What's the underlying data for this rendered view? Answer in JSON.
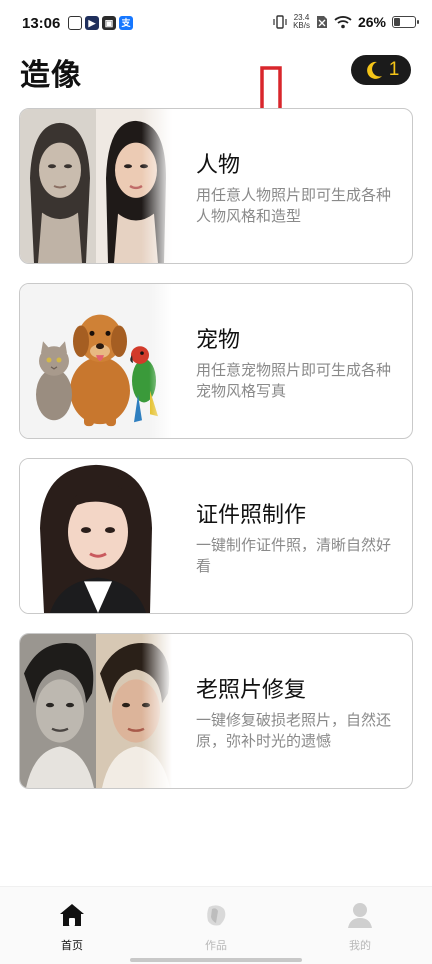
{
  "status_bar": {
    "time": "13:06",
    "speed_value": "23.4",
    "speed_unit": "KB/s",
    "battery": "26%",
    "battery_level": 0.26,
    "icons": [
      "app-icon",
      "play-icon",
      "wallet-icon",
      "alipay-icon",
      "vibrate-icon",
      "sim-off-icon",
      "wifi-icon",
      "battery-icon"
    ]
  },
  "header": {
    "title": "造像",
    "credits": "1",
    "credit_icon": "moon-icon",
    "credit_color": "#f5c518"
  },
  "annotation": {
    "icon": "down-arrow-icon",
    "color": "#d9262c"
  },
  "cards": [
    {
      "title": "人物",
      "description": "用任意人物照片即可生成各种人物风格和造型",
      "image": "portrait-before-after"
    },
    {
      "title": "宠物",
      "description": "用任意宠物照片即可生成各种宠物风格写真",
      "image": "cat-dog-parrot"
    },
    {
      "title": "证件照制作",
      "description": "一键制作证件照，清晰自然好看",
      "image": "id-photo-woman"
    },
    {
      "title": "老照片修复",
      "description": "一键修复破损老照片，自然还原，弥补时光的遗憾",
      "image": "old-photo-restoration"
    }
  ],
  "nav": [
    {
      "label": "首页",
      "icon": "home-icon",
      "active": true
    },
    {
      "label": "作品",
      "icon": "works-icon",
      "active": false
    },
    {
      "label": "我的",
      "icon": "profile-icon",
      "active": false
    }
  ]
}
